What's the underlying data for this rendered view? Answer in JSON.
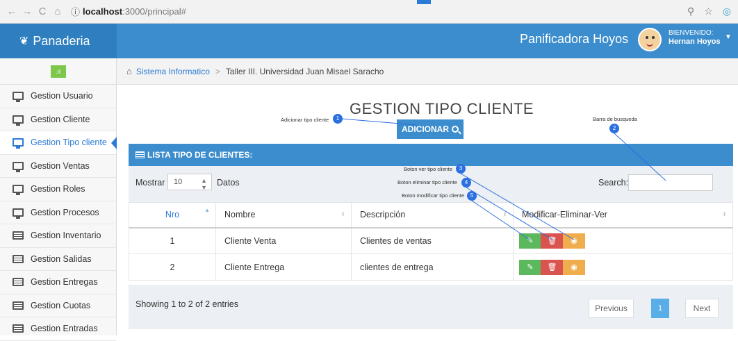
{
  "browser": {
    "back": "←",
    "forward": "→",
    "reload": "C",
    "home": "⌂",
    "info": "ⓘ",
    "host": "localhost",
    "path": ":3000/principal#"
  },
  "navbar": {
    "brand": "Panaderia",
    "company": "Panificadora Hoyos",
    "welcome": "BIENVENIDO:",
    "user": "Hernan Hoyos"
  },
  "sidebar": {
    "items": [
      {
        "label": "Gestion Usuario",
        "icon": "monitor-icon"
      },
      {
        "label": "Gestion Cliente",
        "icon": "monitor-icon"
      },
      {
        "label": "Gestion Tipo cliente",
        "icon": "monitor-icon",
        "active": true
      },
      {
        "label": "Gestion Ventas",
        "icon": "monitor-icon"
      },
      {
        "label": "Gestion Roles",
        "icon": "monitor-icon"
      },
      {
        "label": "Gestion Procesos",
        "icon": "monitor-icon"
      },
      {
        "label": "Gestion Inventario",
        "icon": "list-icon"
      },
      {
        "label": "Gestion Salidas",
        "icon": "list-icon"
      },
      {
        "label": "Gestion Entregas",
        "icon": "list-icon"
      },
      {
        "label": "Gestion Cuotas",
        "icon": "list-icon"
      },
      {
        "label": "Gestion Entradas",
        "icon": "list-icon"
      }
    ]
  },
  "breadcrumb": {
    "link": "Sistema Informatico",
    "sep": ">",
    "current": "Taller III. Universidad Juan Misael Saracho"
  },
  "page": {
    "title": "GESTION TIPO CLIENTE",
    "add_button": "ADICIONAR"
  },
  "annotations": [
    {
      "num": "1",
      "text": "Adicionar tipo cliente"
    },
    {
      "num": "2",
      "text": "Barra de busqueda"
    },
    {
      "num": "3",
      "text": "Boton ver tipo cliente"
    },
    {
      "num": "4",
      "text": "Boton eliminar tipo cliente"
    },
    {
      "num": "5",
      "text": "Boton modificar tipo cliente"
    }
  ],
  "panel": {
    "title": "LISTA TIPO DE CLIENTES:",
    "show_label": "Mostrar",
    "show_value": "10",
    "show_suffix": "Datos",
    "search_label": "Search:",
    "search_value": ""
  },
  "table": {
    "headers": [
      "Nro",
      "Nombre",
      "Descripción",
      "Modificar-Eliminar-Ver"
    ],
    "rows": [
      {
        "nro": "1",
        "nombre": "Cliente Venta",
        "descripcion": "Clientes de ventas"
      },
      {
        "nro": "2",
        "nombre": "Cliente Entrega",
        "descripcion": "clientes de entrega"
      }
    ]
  },
  "footer": {
    "info": "Showing 1 to 2 of 2 entries",
    "previous": "Previous",
    "current_page": "1",
    "next": "Next"
  },
  "colors": {
    "primary": "#3c8dcd",
    "edit": "#5cb85c",
    "delete": "#d9534f",
    "view": "#f0ad4e"
  }
}
